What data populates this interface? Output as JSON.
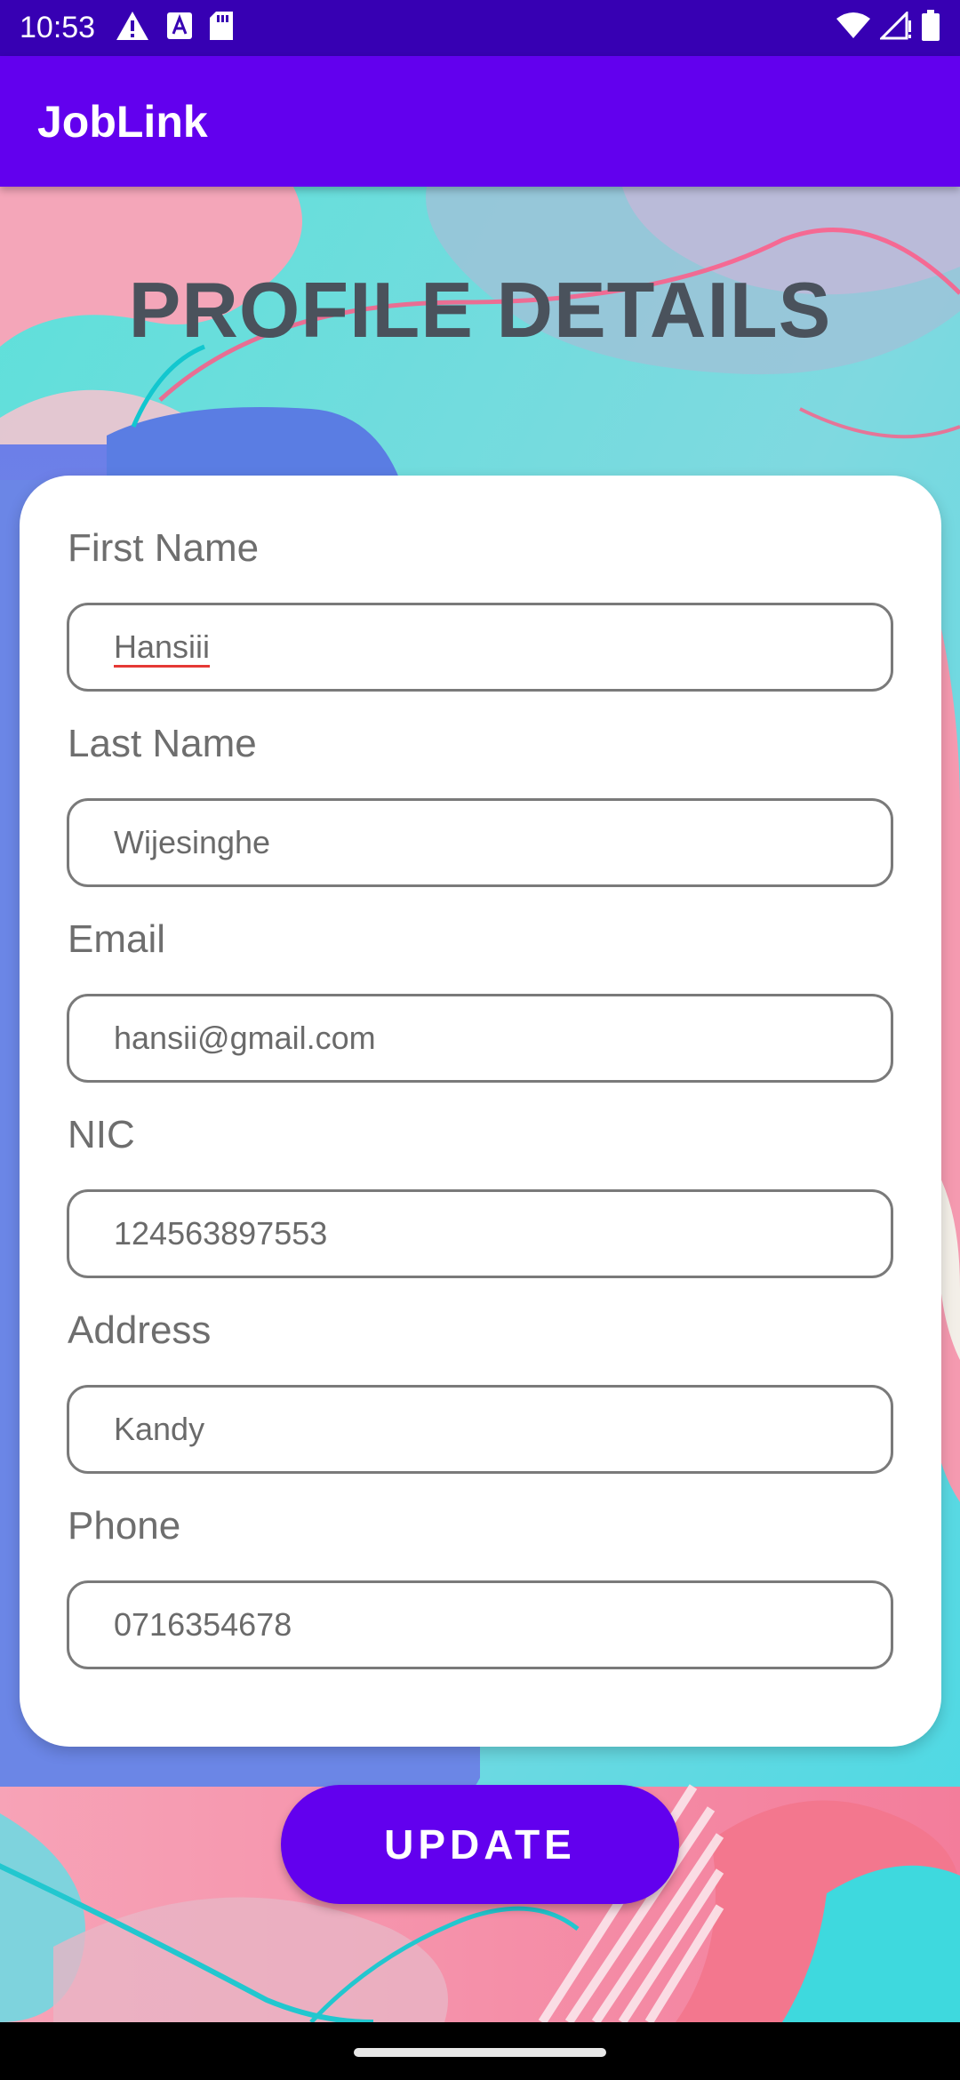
{
  "status_bar": {
    "time": "10:53",
    "left_icons": [
      "alert-icon",
      "accessibility-a-icon",
      "sd-card-icon"
    ],
    "right_icons": [
      "wifi-icon",
      "signal-icon",
      "battery-icon"
    ]
  },
  "app_bar": {
    "title": "JobLink"
  },
  "page": {
    "title": "PROFILE DETAILS"
  },
  "form": {
    "fields": [
      {
        "label": "First Name",
        "value": "Hansiii"
      },
      {
        "label": "Last Name",
        "value": "Wijesinghe"
      },
      {
        "label": "Email",
        "value": "hansii@gmail.com"
      },
      {
        "label": "NIC",
        "value": "124563897553"
      },
      {
        "label": "Address",
        "value": "Kandy"
      },
      {
        "label": "Phone",
        "value": "0716354678"
      }
    ]
  },
  "actions": {
    "update_label": "UPDATE"
  },
  "colors": {
    "status_bar": "#3700b3",
    "app_bar": "#6200ee",
    "button": "#6200ee",
    "title_text": "#4a525c"
  }
}
